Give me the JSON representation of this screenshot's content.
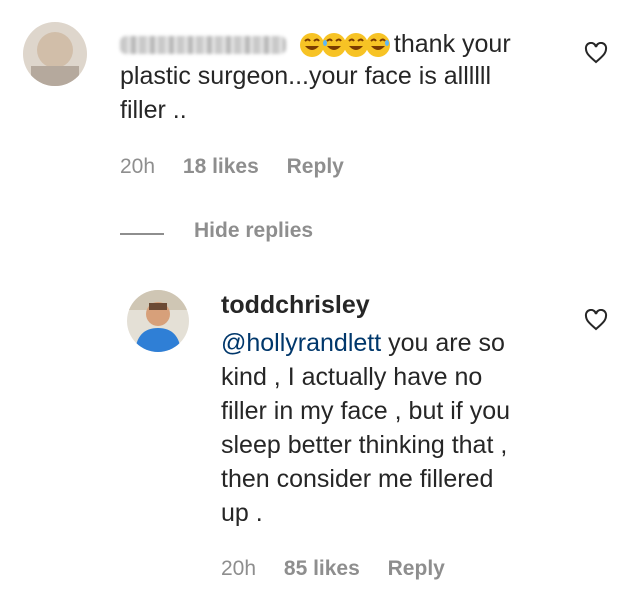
{
  "comment": {
    "emoji_count": 4,
    "text_after_emoji": "thank your",
    "lines": [
      "plastic surgeon...your face is allllll",
      "filler .."
    ],
    "time": "20h",
    "likes": "18 likes",
    "reply": "Reply"
  },
  "hide_replies": "Hide replies",
  "reply": {
    "username": "toddchrisley",
    "mention": "@hollyrandlett",
    "first_line_rest": " you are so",
    "lines": [
      "kind , I actually have no",
      "filler in my face , but if you",
      "sleep better thinking that ,",
      "then consider me fillered",
      "up ."
    ],
    "time": "20h",
    "likes": "85 likes",
    "reply": "Reply"
  },
  "colors": {
    "meta": "#8e8e8e",
    "mention": "#00376b",
    "avatar_shirt": "#2f7fd6"
  }
}
